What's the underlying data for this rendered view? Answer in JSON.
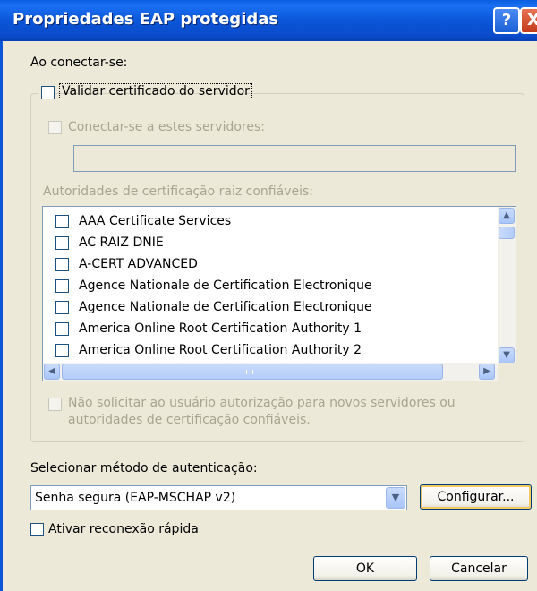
{
  "window": {
    "title": "Propriedades EAP protegidas",
    "help_label": "?",
    "close_label": "X"
  },
  "connect": {
    "heading": "Ao conectar-se:",
    "validate_cert_label": "Validar certificado do servidor",
    "validate_cert_checked": false,
    "connect_servers_label": "Conectar-se a estes servidores:",
    "connect_servers_value": "",
    "trusted_roots_label": "Autoridades de certificação raiz confiáveis:",
    "root_authorities": [
      {
        "label": "AAA Certificate Services",
        "checked": false
      },
      {
        "label": "AC RAIZ DNIE",
        "checked": false
      },
      {
        "label": "A-CERT ADVANCED",
        "checked": false
      },
      {
        "label": "Agence Nationale de Certification Electronique",
        "checked": false
      },
      {
        "label": "Agence Nationale de Certification Electronique",
        "checked": false
      },
      {
        "label": "America Online Root Certification Authority 1",
        "checked": false
      },
      {
        "label": "America Online Root Certification Authority 2",
        "checked": false
      }
    ],
    "no_prompt_line1": "Não solicitar ao usuário autorização para novos servidores ou",
    "no_prompt_line2": "autoridades de certificação confiáveis."
  },
  "auth": {
    "method_label": "Selecionar método de autenticação:",
    "method_value": "Senha segura (EAP-MSCHAP v2)",
    "configure_label": "Configurar...",
    "fast_reconnect_label": "Ativar reconexão rápida",
    "fast_reconnect_checked": false
  },
  "buttons": {
    "ok": "OK",
    "cancel": "Cancelar"
  },
  "colors": {
    "titlebar": "#0b56d8",
    "dialog_bg": "#ece9d8",
    "disabled_text": "#a7a690",
    "default_button_highlight": "#f4c863"
  }
}
